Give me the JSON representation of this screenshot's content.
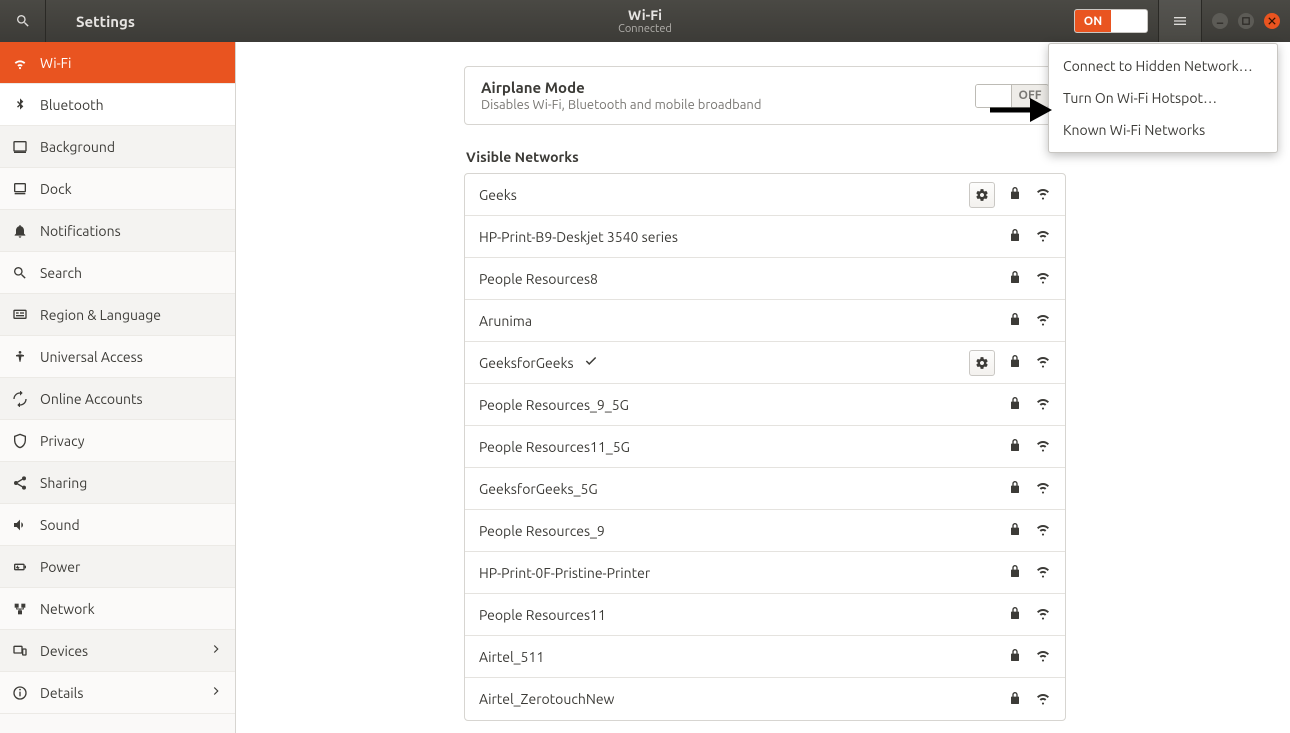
{
  "header": {
    "app_title": "Settings",
    "page_title": "Wi-Fi",
    "page_subtitle": "Connected",
    "on_label": "ON"
  },
  "sidebar": {
    "items": [
      {
        "label": "Wi-Fi"
      },
      {
        "label": "Bluetooth"
      },
      {
        "label": "Background"
      },
      {
        "label": "Dock"
      },
      {
        "label": "Notifications"
      },
      {
        "label": "Search"
      },
      {
        "label": "Region & Language"
      },
      {
        "label": "Universal Access"
      },
      {
        "label": "Online Accounts"
      },
      {
        "label": "Privacy"
      },
      {
        "label": "Sharing"
      },
      {
        "label": "Sound"
      },
      {
        "label": "Power"
      },
      {
        "label": "Network"
      },
      {
        "label": "Devices"
      },
      {
        "label": "Details"
      }
    ]
  },
  "airplane": {
    "title": "Airplane Mode",
    "subtitle": "Disables Wi-Fi, Bluetooth and mobile broadband",
    "off_label": "OFF"
  },
  "visible_networks_label": "Visible Networks",
  "networks": [
    {
      "name": "Geeks",
      "secured": true,
      "gear": true,
      "connected": false
    },
    {
      "name": "HP-Print-B9-Deskjet 3540 series",
      "secured": true,
      "gear": false,
      "connected": false
    },
    {
      "name": "People Resources8",
      "secured": true,
      "gear": false,
      "connected": false
    },
    {
      "name": "Arunima",
      "secured": true,
      "gear": false,
      "connected": false
    },
    {
      "name": "GeeksforGeeks",
      "secured": true,
      "gear": true,
      "connected": true
    },
    {
      "name": "People Resources_9_5G",
      "secured": true,
      "gear": false,
      "connected": false
    },
    {
      "name": "People Resources11_5G",
      "secured": true,
      "gear": false,
      "connected": false
    },
    {
      "name": "GeeksforGeeks_5G",
      "secured": true,
      "gear": false,
      "connected": false
    },
    {
      "name": "People Resources_9",
      "secured": true,
      "gear": false,
      "connected": false
    },
    {
      "name": "HP-Print-0F-Pristine-Printer",
      "secured": true,
      "gear": false,
      "connected": false
    },
    {
      "name": "People Resources11",
      "secured": true,
      "gear": false,
      "connected": false
    },
    {
      "name": "Airtel_511",
      "secured": true,
      "gear": false,
      "connected": false
    },
    {
      "name": "Airtel_ZerotouchNew",
      "secured": true,
      "gear": false,
      "connected": false
    }
  ],
  "dropdown": {
    "items": [
      "Connect to Hidden Network…",
      "Turn On Wi-Fi Hotspot…",
      "Known Wi-Fi Networks"
    ]
  }
}
